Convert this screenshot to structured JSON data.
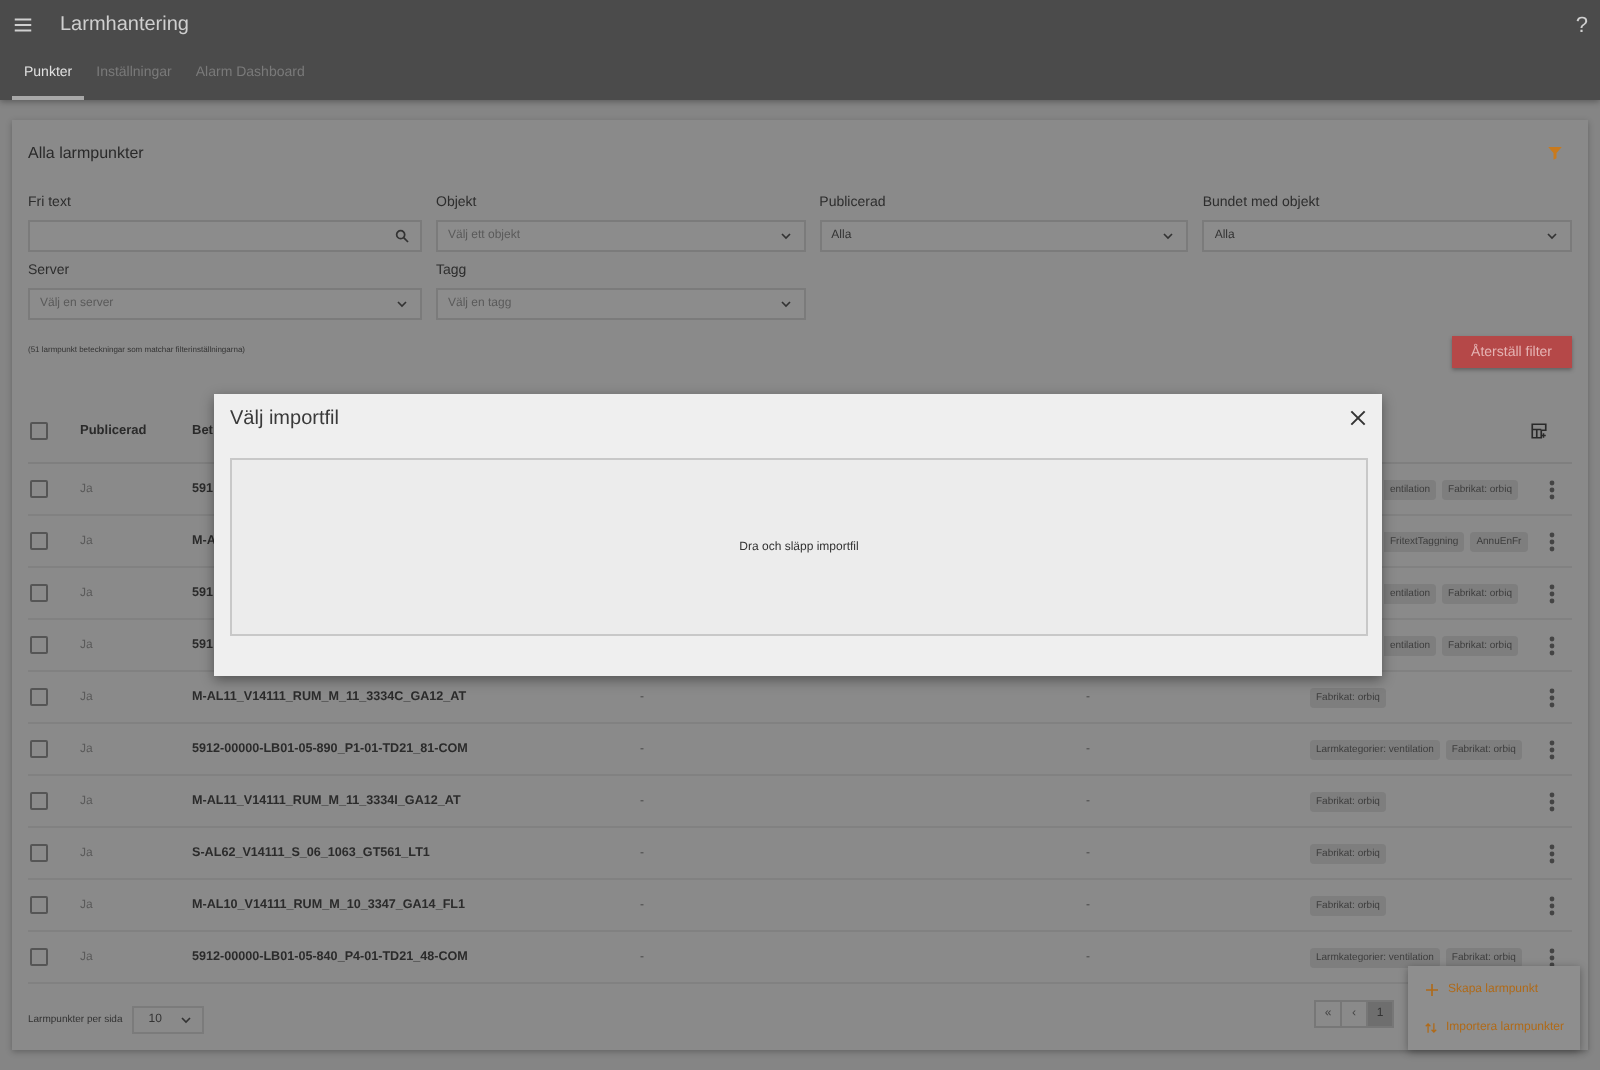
{
  "app_bar": {
    "title": "Larmhantering",
    "help": "?"
  },
  "tabs": [
    {
      "label": "Punkter",
      "selected": true
    },
    {
      "label": "Inställningar",
      "selected": false
    },
    {
      "label": "Alarm Dashboard",
      "selected": false
    }
  ],
  "card": {
    "title": "Alla larmpunkter"
  },
  "filters": [
    {
      "label": "Fri text",
      "kind": "search"
    },
    {
      "label": "Objekt",
      "kind": "select",
      "placeholder": "Välj ett objekt"
    },
    {
      "label": "Publicerad",
      "kind": "select",
      "value": "Alla"
    },
    {
      "label": "Bundet med objekt",
      "kind": "select",
      "value": "Alla"
    },
    {
      "label": "Server",
      "kind": "select",
      "placeholder": "Välj en server"
    },
    {
      "label": "Tagg",
      "kind": "select",
      "placeholder": "Välj en tagg"
    }
  ],
  "result_info": "(51 larmpunkt beteckningar som matchar filterinställningarna)",
  "reset_button": "Återställ filter",
  "table": {
    "select_all": {
      "checked": false
    },
    "columns": [
      {
        "label": "Publicerad"
      },
      {
        "label": "Bet"
      }
    ],
    "rows": [
      {
        "checked": false,
        "published": "Ja",
        "name": "591",
        "tags": [
          "entilation",
          "Fabrikat: orbiq"
        ]
      },
      {
        "checked": false,
        "published": "Ja",
        "name": "M-A",
        "tags": [
          "FritextTaggning",
          "AnnuEnFr"
        ]
      },
      {
        "checked": false,
        "published": "Ja",
        "name": "591",
        "tags": [
          "entilation",
          "Fabrikat: orbiq"
        ]
      },
      {
        "checked": false,
        "published": "Ja",
        "name": "591",
        "tags": [
          "entilation",
          "Fabrikat: orbiq"
        ]
      },
      {
        "checked": false,
        "published": "Ja",
        "name": "M-AL11_V14111_RUM_M_11_3334C_GA12_AT",
        "column_4": "-",
        "column_5": "-",
        "tags": [
          "Fabrikat: orbiq"
        ]
      },
      {
        "checked": false,
        "published": "Ja",
        "name": "5912-00000-LB01-05-890_P1-01-TD21_81-COM",
        "column_4": "-",
        "column_5": "-",
        "tags": [
          "Larmkategorier: ventilation",
          "Fabrikat: orbiq"
        ]
      },
      {
        "checked": false,
        "published": "Ja",
        "name": "M-AL11_V14111_RUM_M_11_3334I_GA12_AT",
        "column_4": "-",
        "column_5": "-",
        "tags": [
          "Fabrikat: orbiq"
        ]
      },
      {
        "checked": false,
        "published": "Ja",
        "name": "S-AL62_V14111_S_06_1063_GT561_LT1",
        "column_4": "-",
        "column_5": "-",
        "tags": [
          "Fabrikat: orbiq"
        ]
      },
      {
        "checked": false,
        "published": "Ja",
        "name": "M-AL10_V14111_RUM_M_10_3347_GA14_FL1",
        "column_4": "-",
        "column_5": "-",
        "tags": [
          "Fabrikat: orbiq"
        ]
      },
      {
        "checked": false,
        "published": "Ja",
        "name": "5912-00000-LB01-05-840_P4-01-TD21_48-COM",
        "column_4": "-",
        "column_5": "-",
        "tags": [
          "Larmkategorier: ventilation",
          "Fabrikat: orbiq"
        ]
      }
    ]
  },
  "footer": {
    "per_page_label": "Larmpunkter per sida",
    "per_page": "10"
  },
  "pagination": [
    {
      "label": "«",
      "selected": false
    },
    {
      "label": "‹",
      "selected": false
    },
    {
      "label": "1",
      "selected": true
    }
  ],
  "fab_menu": [
    {
      "label": "Skapa larmpunkt",
      "kind": "create"
    },
    {
      "label": "Importera larmpunkter",
      "kind": "import"
    }
  ],
  "dialog": {
    "title": "Välj importfil",
    "drop_text": "Dra och släpp importfil"
  }
}
